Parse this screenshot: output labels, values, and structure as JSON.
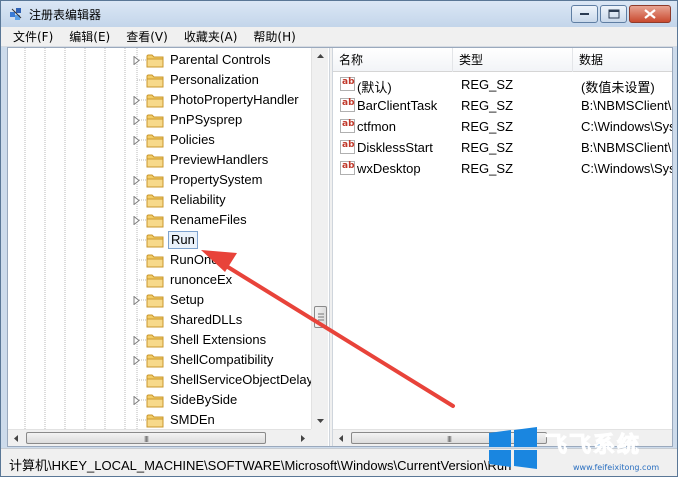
{
  "window": {
    "title": "注册表编辑器",
    "buttons": {
      "minimize": "minimize",
      "maximize": "maximize",
      "close": "close"
    }
  },
  "menu": [
    {
      "label": "文件(F)"
    },
    {
      "label": "编辑(E)"
    },
    {
      "label": "查看(V)"
    },
    {
      "label": "收藏夹(A)"
    },
    {
      "label": "帮助(H)"
    }
  ],
  "tree": {
    "items": [
      {
        "label": "Parental Controls",
        "expandable": true
      },
      {
        "label": "Personalization",
        "expandable": false
      },
      {
        "label": "PhotoPropertyHandler",
        "expandable": true
      },
      {
        "label": "PnPSysprep",
        "expandable": true
      },
      {
        "label": "Policies",
        "expandable": true
      },
      {
        "label": "PreviewHandlers",
        "expandable": false
      },
      {
        "label": "PropertySystem",
        "expandable": true
      },
      {
        "label": "Reliability",
        "expandable": true
      },
      {
        "label": "RenameFiles",
        "expandable": true
      },
      {
        "label": "Run",
        "expandable": false,
        "selected": true
      },
      {
        "label": "RunOnce",
        "expandable": false
      },
      {
        "label": "runonceEx",
        "expandable": false
      },
      {
        "label": "Setup",
        "expandable": true
      },
      {
        "label": "SharedDLLs",
        "expandable": false
      },
      {
        "label": "Shell Extensions",
        "expandable": true
      },
      {
        "label": "ShellCompatibility",
        "expandable": true
      },
      {
        "label": "ShellServiceObjectDelayL",
        "expandable": false
      },
      {
        "label": "SideBySide",
        "expandable": true
      },
      {
        "label": "SMDEn",
        "expandable": false
      }
    ]
  },
  "list": {
    "columns": {
      "name": "名称",
      "type": "类型",
      "data": "数据"
    },
    "rows": [
      {
        "name": "(默认)",
        "type": "REG_SZ",
        "data": "(数值未设置)"
      },
      {
        "name": "BarClientTask",
        "type": "REG_SZ",
        "data": "B:\\NBMSClient\\"
      },
      {
        "name": "ctfmon",
        "type": "REG_SZ",
        "data": "C:\\Windows\\Sys"
      },
      {
        "name": "DisklessStart",
        "type": "REG_SZ",
        "data": "B:\\NBMSClient\\"
      },
      {
        "name": "wxDesktop",
        "type": "REG_SZ",
        "data": "C:\\Windows\\Sys"
      }
    ],
    "icon": "ab",
    "scroll_grip": "III"
  },
  "status": {
    "path": "计算机\\HKEY_LOCAL_MACHINE\\SOFTWARE\\Microsoft\\Windows\\CurrentVersion\\Run"
  },
  "watermark": {
    "brand": "飞飞系统",
    "url": "www.feifeixitong.com"
  },
  "colors": {
    "arrow": "#e8433a",
    "selection_border": "#7da2ce",
    "folder": "#e8b84a"
  }
}
